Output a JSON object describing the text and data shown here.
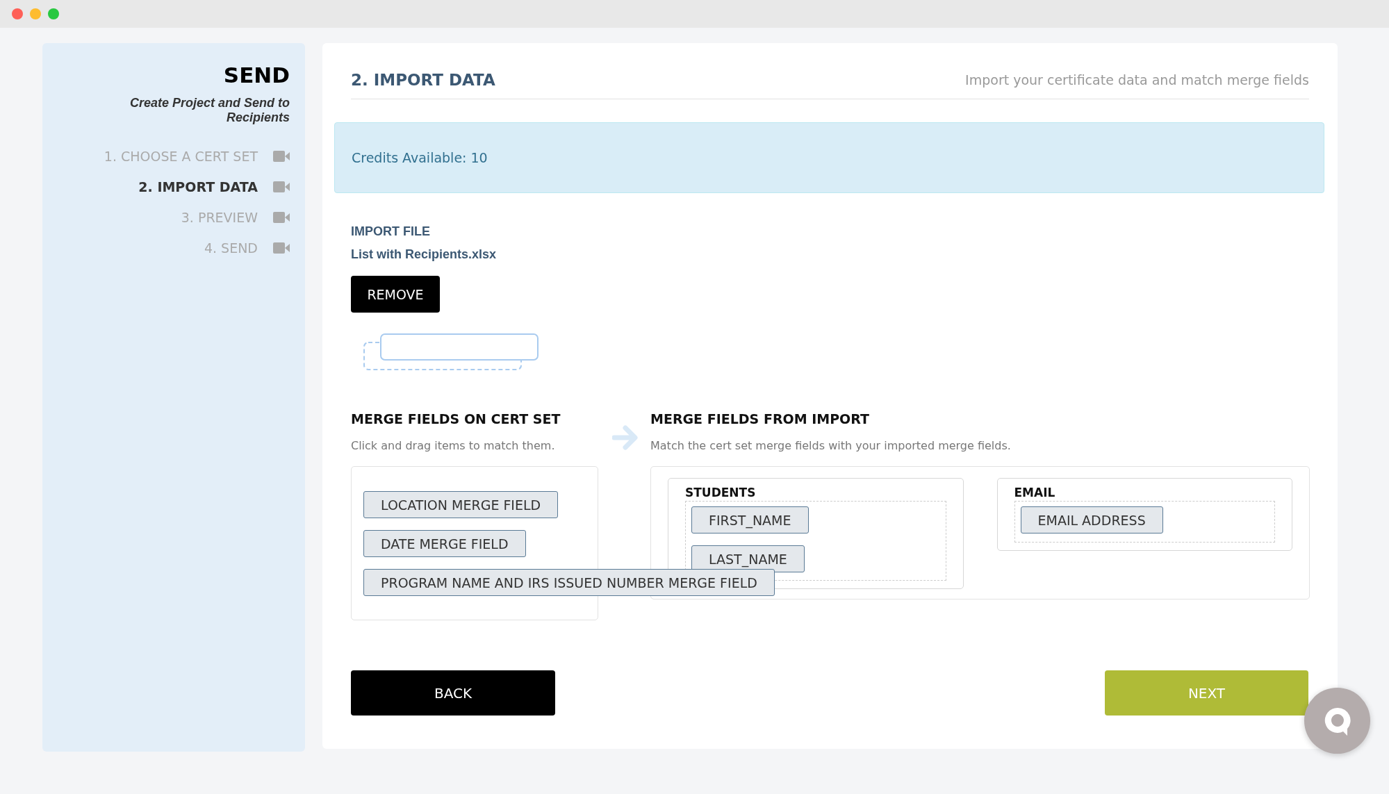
{
  "sidebar": {
    "title": "SEND",
    "subtitle": "Create Project and Send to Recipients",
    "steps": [
      {
        "label": "1. CHOOSE A CERT SET",
        "selected": false
      },
      {
        "label": "2. IMPORT DATA",
        "selected": true
      },
      {
        "label": "3. PREVIEW",
        "selected": false
      },
      {
        "label": "4. SEND",
        "selected": false
      }
    ]
  },
  "header": {
    "title": "2. IMPORT DATA",
    "description": "Import your certificate data and match merge fields"
  },
  "credits": {
    "text": "Credits Available: 10"
  },
  "import_file": {
    "label": "IMPORT FILE",
    "filename": "List with Recipients.xlsx",
    "button": "REMOVE"
  },
  "cert_set": {
    "heading": "MERGE FIELDS ON CERT SET",
    "hint": "Click and drag items to match them.",
    "fields": [
      "LOCATION MERGE FIELD",
      "DATE MERGE FIELD",
      "PROGRAM NAME AND IRS ISSUED NUMBER MERGE FIELD"
    ]
  },
  "import": {
    "heading": "MERGE FIELDS FROM IMPORT",
    "hint": "Match the cert set merge fields with your imported merge fields.",
    "groups": [
      {
        "title": "STUDENTS",
        "fields": [
          "FIRST_NAME",
          "LAST_NAME"
        ]
      },
      {
        "title": "EMAIL",
        "fields": [
          "EMAIL ADDRESS"
        ]
      }
    ]
  },
  "buttons": {
    "back": "BACK",
    "next": "NEXT"
  }
}
